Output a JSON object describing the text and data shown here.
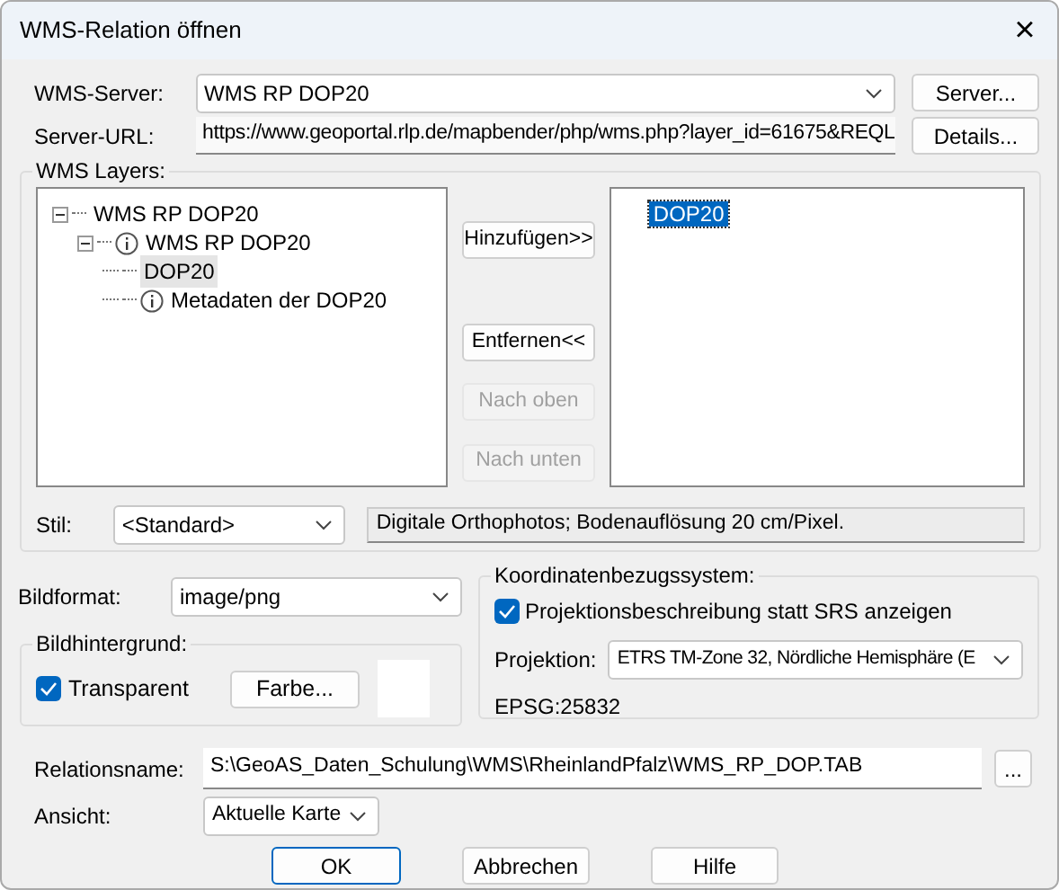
{
  "window": {
    "title": "WMS-Relation öffnen",
    "close": "×"
  },
  "server": {
    "label": "WMS-Server:",
    "value": "WMS RP DOP20",
    "button": "Server..."
  },
  "url": {
    "label": "Server-URL:",
    "value": "https://www.geoportal.rlp.de/mapbender/php/wms.php?layer_id=61675&REQL",
    "button": "Details..."
  },
  "layers": {
    "title": "WMS Layers:",
    "tree": [
      {
        "label": "WMS RP DOP20",
        "info": false,
        "expanded": true,
        "selected": false,
        "children": [
          {
            "label": "WMS RP DOP20",
            "info": true,
            "expanded": true,
            "selected": false,
            "children": [
              {
                "label": "DOP20",
                "info": false,
                "selected": true
              },
              {
                "label": "Metadaten der DOP20",
                "info": true,
                "selected": false
              }
            ]
          }
        ]
      }
    ],
    "buttons": [
      {
        "label": "Hinzufügen>>",
        "disabled": false
      },
      {
        "label": "Entfernen<<",
        "disabled": false
      },
      {
        "label": "Nach oben",
        "disabled": true
      },
      {
        "label": "Nach unten",
        "disabled": true
      }
    ],
    "selected_layers": [
      {
        "label": "DOP20",
        "selected": true
      }
    ],
    "style": {
      "label": "Stil:",
      "value": "<Standard>"
    },
    "description": "Digitale Orthophotos; Bodenauflösung 20 cm/Pixel."
  },
  "image_format": {
    "label": "Bildformat:",
    "value": "image/png"
  },
  "background": {
    "title": "Bildhintergrund:",
    "transparent_label": "Transparent",
    "checked": true,
    "button": "Farbe..."
  },
  "crs": {
    "title": "Koordinatenbezugssystem:",
    "checkbox_label": "Projektionsbeschreibung statt SRS anzeigen",
    "checked": true,
    "projection_label": "Projektion:",
    "projection": "ETRS TM-Zone 32, Nördliche Hemisphäre (E",
    "code": "EPSG:25832"
  },
  "relation": {
    "label": "Relationsname:",
    "value": "S:\\GeoAS_Daten_Schulung\\WMS\\RheinlandPfalz\\WMS_RP_DOP.TAB",
    "button": "..."
  },
  "view": {
    "label": "Ansicht:",
    "value": "Aktuelle Karte"
  },
  "dialog_buttons": [
    {
      "label": "OK",
      "default": true
    },
    {
      "label": "Abbrechen",
      "default": false
    },
    {
      "label": "Hilfe",
      "default": false
    }
  ]
}
